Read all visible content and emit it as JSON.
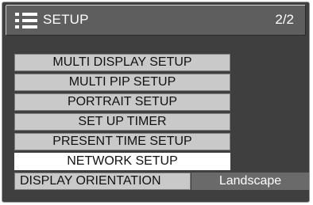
{
  "header": {
    "title": "SETUP",
    "page_indicator": "2/2",
    "icon": "menu-list-icon"
  },
  "menu": {
    "items": [
      {
        "label": "MULTI DISPLAY SETUP",
        "selected": false
      },
      {
        "label": "MULTI PIP SETUP",
        "selected": false
      },
      {
        "label": "PORTRAIT SETUP",
        "selected": false
      },
      {
        "label": "SET UP TIMER",
        "selected": false
      },
      {
        "label": "PRESENT TIME SETUP",
        "selected": false
      },
      {
        "label": "NETWORK SETUP",
        "selected": true
      }
    ],
    "orientation": {
      "label": "DISPLAY ORIENTATION",
      "value": "Landscape"
    }
  },
  "colors": {
    "panel_bg": "#3f3f3f",
    "titlebar_bg": "#5e5e5e",
    "item_bg": "#c9c9c9",
    "selected_bg": "#ffffff",
    "value_bg": "#6a6a6a"
  }
}
